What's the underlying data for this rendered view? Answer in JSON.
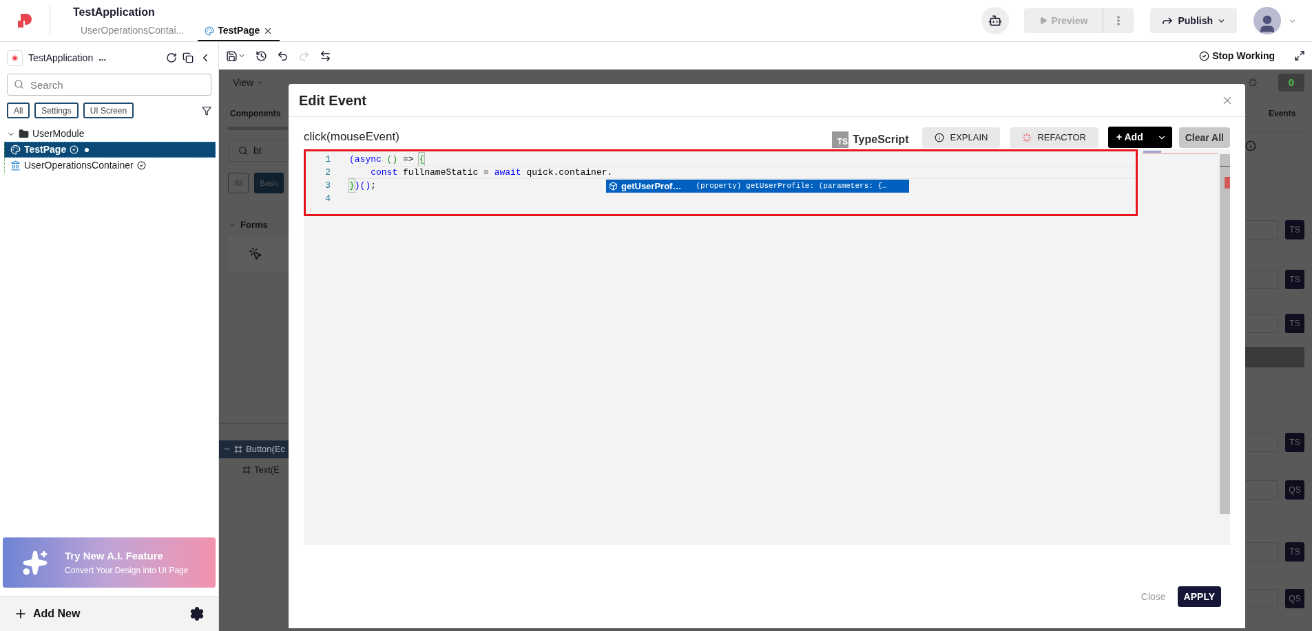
{
  "app_bar": {
    "title": "TestApplication",
    "tabs": [
      {
        "label": "UserOperationsContai...",
        "kind": "container",
        "selected": false
      },
      {
        "label": "TestPage",
        "kind": "page",
        "selected": true
      }
    ],
    "preview": {
      "label": "Preview",
      "disabled": true
    },
    "publish": {
      "label": "Publish"
    }
  },
  "sidebar": {
    "app_name": "TestApplication",
    "more": "...",
    "search": {
      "placeholder": "Search"
    },
    "filters": [
      {
        "label": "All"
      },
      {
        "label": "Settings"
      },
      {
        "label": "UI Screen"
      }
    ],
    "tree": [
      {
        "label": "UserModule",
        "kind": "module",
        "expanded": true,
        "selected": false,
        "children": [
          {
            "label": "TestPage",
            "kind": "page",
            "selected": true,
            "unsaved": true
          },
          {
            "label": "UserOperationsContainer",
            "kind": "container",
            "selected": false,
            "unsaved": false
          }
        ]
      }
    ],
    "ai_card": {
      "title": "Try New A.I. Feature",
      "subtitle": "Convert Your Design into UI Page"
    },
    "add_new": "Add New"
  },
  "toolbar": {
    "redo_disabled": true,
    "stop_working": "Stop Working"
  },
  "background": {
    "menu": "View",
    "components_tab": "Components",
    "search_value": "bt",
    "chips": [
      {
        "label": "All",
        "selected": false
      },
      {
        "label": "Basic",
        "selected": true
      }
    ],
    "section": "Forms",
    "outline": [
      {
        "label": "Button(Ec",
        "selected": true,
        "children": [
          {
            "label": "Text(E",
            "selected": false
          }
        ]
      }
    ],
    "counter": "0",
    "events_tab": "Events",
    "fields": [
      {
        "kind": "field",
        "badge": "TS"
      },
      {
        "kind": "field",
        "badge": "TS"
      },
      {
        "kind": "field",
        "badge": "TS"
      },
      {
        "kind": "button"
      },
      {
        "kind": "field",
        "badge": "TS"
      },
      {
        "kind": "field",
        "badge": "QS"
      },
      {
        "kind": "field",
        "badge": "TS"
      },
      {
        "kind": "field",
        "badge": "QS"
      }
    ]
  },
  "dialog": {
    "title": "Edit Event",
    "signature": "click(mouseEvent)",
    "language": {
      "badge": "TS",
      "label": "TypeScript"
    },
    "actions": [
      {
        "label": "EXPLAIN",
        "kind": "explain"
      },
      {
        "label": "REFACTOR",
        "kind": "refactor"
      }
    ],
    "add": "+ Add",
    "clear": "Clear All",
    "code": [
      {
        "number": "1",
        "tokens": [
          {
            "text": "(async",
            "kind": "keyword"
          },
          {
            "text": " ()",
            "kind": "bracket"
          },
          {
            "text": " => ",
            "kind": "plain"
          },
          {
            "text": "{",
            "kind": "match"
          }
        ]
      },
      {
        "number": "2",
        "current": true,
        "tokens": [
          {
            "text": "    const",
            "kind": "keyword"
          },
          {
            "text": " fullnameStatic = ",
            "kind": "plain"
          },
          {
            "text": "await",
            "kind": "keyword"
          },
          {
            "text": " quick.container.",
            "kind": "plain"
          }
        ]
      },
      {
        "number": "3",
        "tokens": [
          {
            "text": "}",
            "kind": "match"
          },
          {
            "text": ")()",
            "kind": "keyword"
          },
          {
            "text": ";",
            "kind": "plain"
          }
        ]
      },
      {
        "number": "4"
      }
    ],
    "suggestion": {
      "name": "getUserProf…",
      "detail": "(property) getUserProfile: (parameters: {…"
    },
    "close": "Close",
    "apply": "APPLY"
  }
}
